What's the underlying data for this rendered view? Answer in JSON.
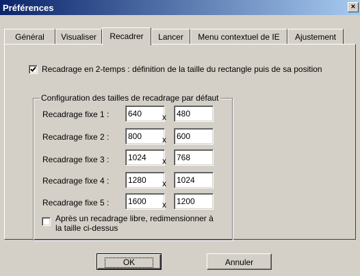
{
  "window": {
    "title": "Préférences",
    "close_glyph": "×"
  },
  "tabs": [
    {
      "label": "Général"
    },
    {
      "label": "Visualiser"
    },
    {
      "label": "Recadrer",
      "active": true
    },
    {
      "label": "Lancer"
    },
    {
      "label": "Menu contextuel de IE"
    },
    {
      "label": "Ajustement"
    }
  ],
  "two_step": {
    "checked": true,
    "label": "Recadrage en 2-temps : définition de la taille du rectangle puis de sa position"
  },
  "group": {
    "title": "Configuration des tailles de recadrage par défaut",
    "separator": "x",
    "rows": [
      {
        "label": "Recadrage fixe 1 :",
        "width": "640",
        "height": "480"
      },
      {
        "label": "Recadrage fixe 2 :",
        "width": "800",
        "height": "600"
      },
      {
        "label": "Recadrage fixe 3 :",
        "width": "1024",
        "height": "768"
      },
      {
        "label": "Recadrage fixe 4 :",
        "width": "1280",
        "height": "1024"
      },
      {
        "label": "Recadrage fixe 5 :",
        "width": "1600",
        "height": "1200"
      }
    ],
    "resize_option": {
      "checked": false,
      "line1": "Après un recadrage libre, redimensionner à",
      "line2": "la taille ci-dessus"
    }
  },
  "buttons": {
    "ok": "OK",
    "cancel": "Annuler"
  },
  "colors": {
    "titlebar_start": "#0a246a",
    "titlebar_end": "#a6caf0",
    "face": "#d4d0c8"
  }
}
